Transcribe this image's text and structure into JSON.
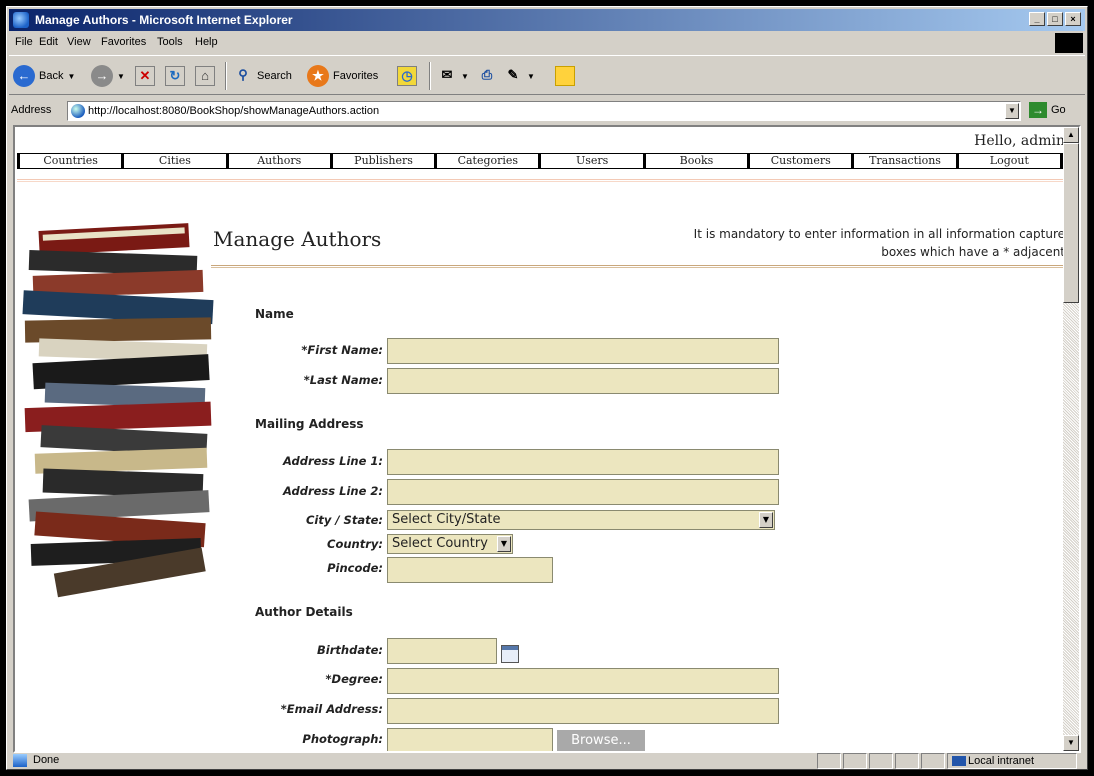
{
  "window": {
    "title": "Manage Authors - Microsoft Internet Explorer"
  },
  "menu": [
    "File",
    "Edit",
    "View",
    "Favorites",
    "Tools",
    "Help"
  ],
  "toolbar": {
    "back_label": "Back",
    "search_label": "Search",
    "favorites_label": "Favorites"
  },
  "address": {
    "label": "Address",
    "url": "http://localhost:8080/BookShop/showManageAuthors.action",
    "go_label": "Go"
  },
  "page": {
    "greeting": "Hello, admin",
    "nav": [
      "Countries",
      "Cities",
      "Authors",
      "Publishers",
      "Categories",
      "Users",
      "Books",
      "Customers",
      "Transactions",
      "Logout"
    ],
    "title": "Manage Authors",
    "mandatory_note": "It is mandatory to enter information in all information capture boxes which have a * adjacent",
    "sections": {
      "name": "Name",
      "mailing": "Mailing Address",
      "author_details": "Author Details"
    },
    "labels": {
      "first_name": "*First Name:",
      "last_name": "*Last Name:",
      "address1": "Address Line 1:",
      "address2": "Address Line 2:",
      "city_state": "City / State:",
      "country": "Country:",
      "pincode": "Pincode:",
      "birthdate": "Birthdate:",
      "degree": "*Degree:",
      "email": "*Email Address:",
      "photograph": "Photograph:"
    },
    "city_select_value": "Select City/State",
    "country_select_value": "Select Country",
    "browse_label": "Browse..."
  },
  "status": {
    "text": "Done",
    "zone": "Local intranet"
  },
  "colors": {
    "input_bg": "#ece6bf",
    "titlebar_start": "#0a246a",
    "titlebar_end": "#a6caf0"
  }
}
